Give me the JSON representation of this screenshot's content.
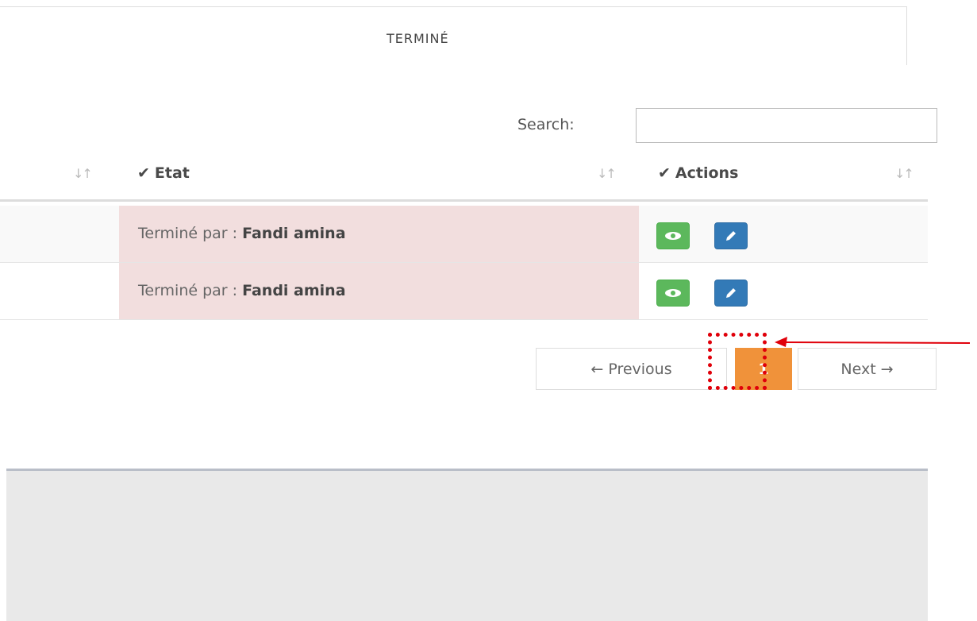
{
  "tab": {
    "label": "TERMINÉ"
  },
  "search": {
    "label": "Search:",
    "value": ""
  },
  "table": {
    "columns": [
      {
        "label": ""
      },
      {
        "label": "Etat"
      },
      {
        "label": "Actions"
      }
    ],
    "rows": [
      {
        "etat_prefix": "Terminé par : ",
        "etat_name": "Fandi amina"
      },
      {
        "etat_prefix": "Terminé par : ",
        "etat_name": "Fandi amina"
      }
    ]
  },
  "icons": {
    "check": "checkmark-icon",
    "sort": "sort-icon",
    "view": "eye-icon",
    "edit": "pencil-icon",
    "arrow": "red-arrow-annotation"
  },
  "pagination": {
    "previous": "← Previous",
    "current": "1",
    "next": "Next →"
  },
  "colors": {
    "row_danger": "#f2dede",
    "btn_view": "#5cb85c",
    "btn_edit": "#337ab7",
    "page_active": "#f0923a",
    "annotation": "#e0000a"
  }
}
